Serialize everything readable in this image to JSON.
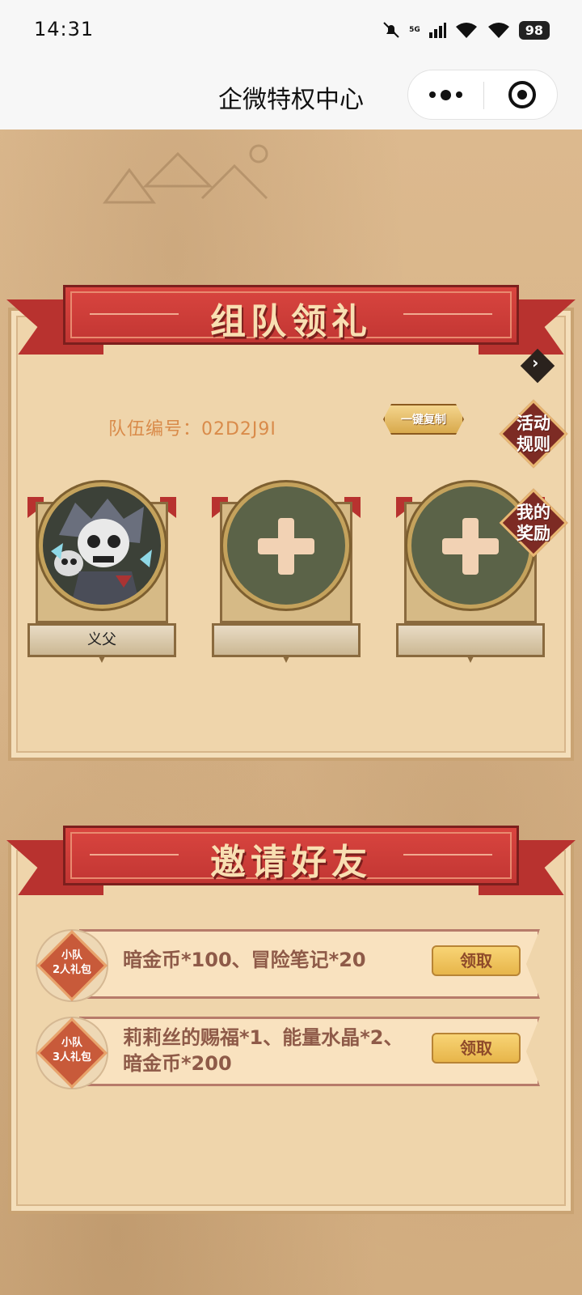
{
  "status_bar": {
    "time": "14:31",
    "network": "5G",
    "battery": "98"
  },
  "title_bar": {
    "title": "企微特权中心"
  },
  "team_section": {
    "banner_title": "组队领礼",
    "team_code_label": "队伍编号：02D2J9I",
    "copy_button": "一键复制",
    "rules_badge": "活动\n规则",
    "rewards_badge": "我的\n奖励",
    "members": [
      {
        "name": "义父",
        "filled": true
      },
      {
        "name": "",
        "filled": false
      },
      {
        "name": "",
        "filled": false
      }
    ]
  },
  "invite_section": {
    "banner_title": "邀请好友",
    "rewards": [
      {
        "badge": "小队\n2人礼包",
        "text": "暗金币*100、冒险笔记*20",
        "button": "领取"
      },
      {
        "badge": "小队\n3人礼包",
        "text": "莉莉丝的赐福*1、能量水晶*2、暗金币*200",
        "button": "领取"
      }
    ]
  },
  "colors": {
    "banner_red": "#c23633",
    "parchment": "#efd5ab",
    "button_gold": "#e7b54a"
  }
}
